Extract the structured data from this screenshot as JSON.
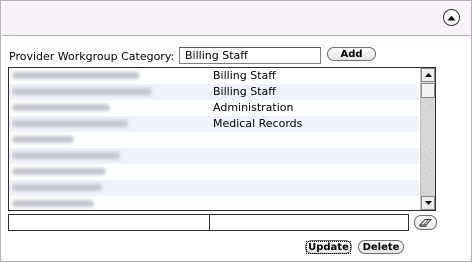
{
  "panel": {
    "collapse_icon": "chevron-up-icon",
    "category_label": "Provider Workgroup Category:",
    "category_value": "Billing Staff",
    "add_label": "Add",
    "update_label": "Update",
    "delete_label": "Delete",
    "clear_icon": "eraser-icon"
  },
  "providers": [
    {
      "name": "Abbott MD, Matthew",
      "category": "Billing Staff"
    },
    {
      "name": "Adams MD, Benjamin Peds",
      "category": "Billing Staff"
    },
    {
      "name": "Anderson, Barry FP",
      "category": "Administration"
    },
    {
      "name": "Baker DO, Michael FP",
      "category": "Medical Records"
    },
    {
      "name": "Banks, Lisa NP",
      "category": ""
    },
    {
      "name": "Broadway, Thomas Peds",
      "category": ""
    },
    {
      "name": "Fisher, Steven Ophth",
      "category": ""
    },
    {
      "name": "Goodby, James FP",
      "category": ""
    },
    {
      "name": "Jordan, John IM",
      "category": ""
    }
  ],
  "colors": {
    "header_bg": "#f7f2f7",
    "alt_row_bg": "#eef2fb",
    "border": "#2d2d2d"
  }
}
